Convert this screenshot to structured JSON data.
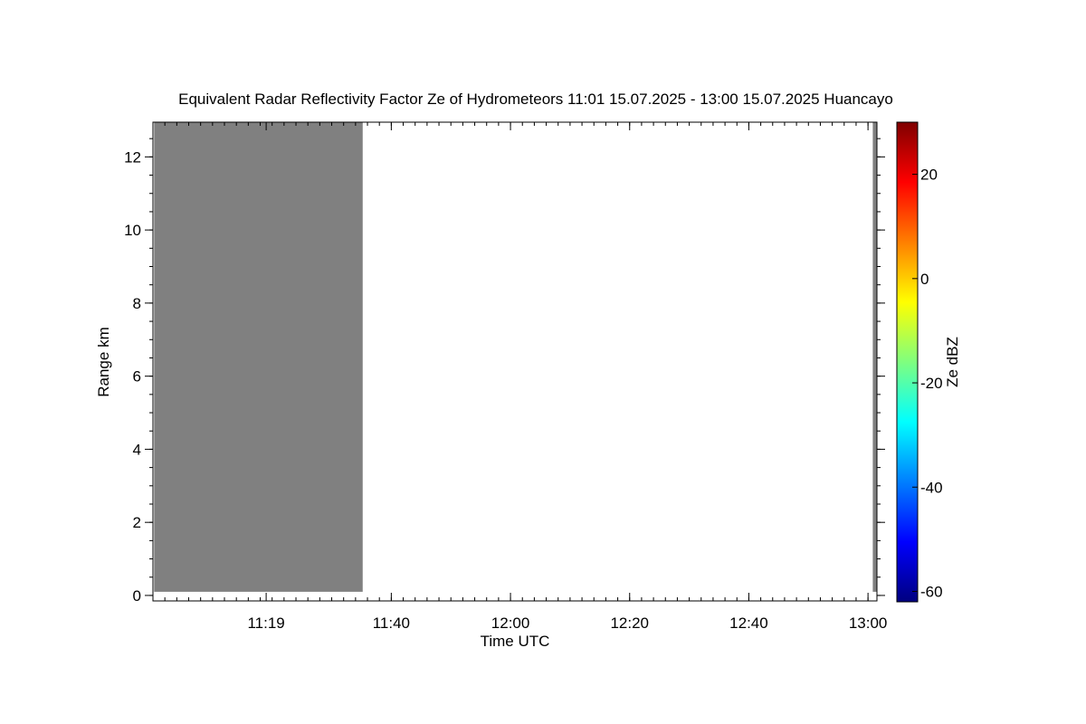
{
  "chart_data": {
    "type": "heatmap",
    "title": "Equivalent Radar Reflectivity Factor Ze of Hydrometeors   11:01 15.07.2025 - 13:00 15.07.2025 Huancayo",
    "xlabel": "Time UTC",
    "ylabel": "Range km",
    "x_ticks": [
      {
        "label": "11:19",
        "minutes": 79
      },
      {
        "label": "11:40",
        "minutes": 100
      },
      {
        "label": "12:00",
        "minutes": 120
      },
      {
        "label": "12:20",
        "minutes": 140
      },
      {
        "label": "12:40",
        "minutes": 160
      },
      {
        "label": "13:00",
        "minutes": 180
      }
    ],
    "xlim_minutes": [
      60,
      181.5
    ],
    "y_ticks": [
      0,
      2,
      4,
      6,
      8,
      10,
      12
    ],
    "ylim": [
      -0.15,
      12.95
    ],
    "no_data_regions": [
      {
        "x_start_minutes": 60.2,
        "x_end_minutes": 95.2,
        "y_start": 0.1,
        "y_end": 12.95,
        "color": "#808080"
      },
      {
        "x_start_minutes": 180.8,
        "x_end_minutes": 181.5,
        "y_start": 0.1,
        "y_end": 12.95,
        "color": "#808080"
      }
    ],
    "colorbar": {
      "label": "Ze dBZ",
      "range": [
        -62,
        30
      ],
      "ticks": [
        -60,
        -40,
        -20,
        0,
        20
      ],
      "colormap": [
        "#00007f",
        "#0000ff",
        "#007fff",
        "#00ffff",
        "#7fff7f",
        "#ffff00",
        "#ff7f00",
        "#ff0000",
        "#7f0000"
      ]
    },
    "grid": false
  }
}
